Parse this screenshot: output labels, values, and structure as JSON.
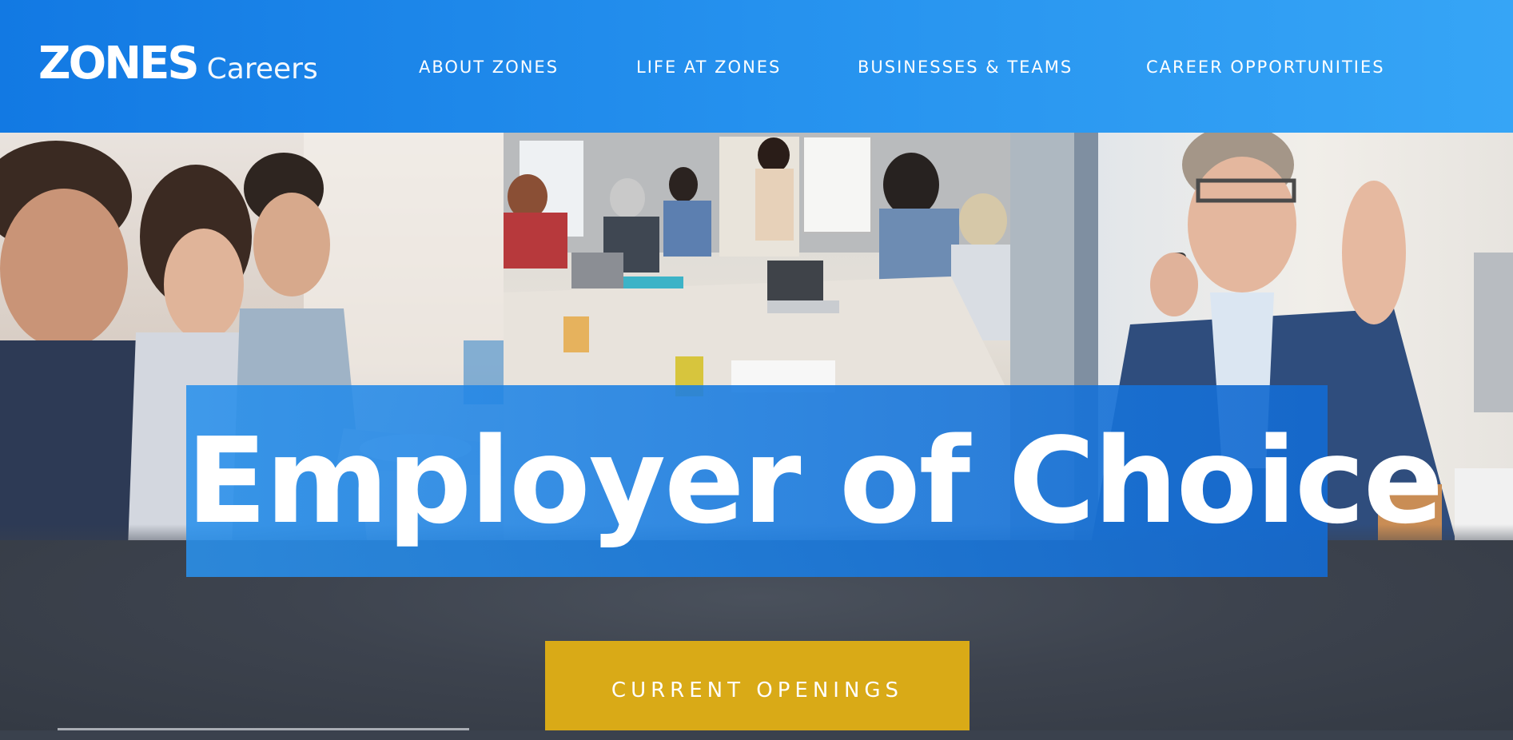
{
  "brand": {
    "logo_text": "ZONES",
    "logo_subtext": "Careers"
  },
  "nav": {
    "items": [
      {
        "label": "ABOUT ZONES"
      },
      {
        "label": "LIFE AT ZONES"
      },
      {
        "label": "BUSINESSES & TEAMS"
      },
      {
        "label": "CAREER OPPORTUNITIES"
      }
    ]
  },
  "hero": {
    "title": "Employer of Choice",
    "cta_label": "CURRENT OPENINGS"
  },
  "colors": {
    "header_start": "#1279e3",
    "header_end": "#36a5f6",
    "hero_overlay": "#1c7de0",
    "cta": "#d9aa17",
    "footer_band": "#3a414d"
  }
}
